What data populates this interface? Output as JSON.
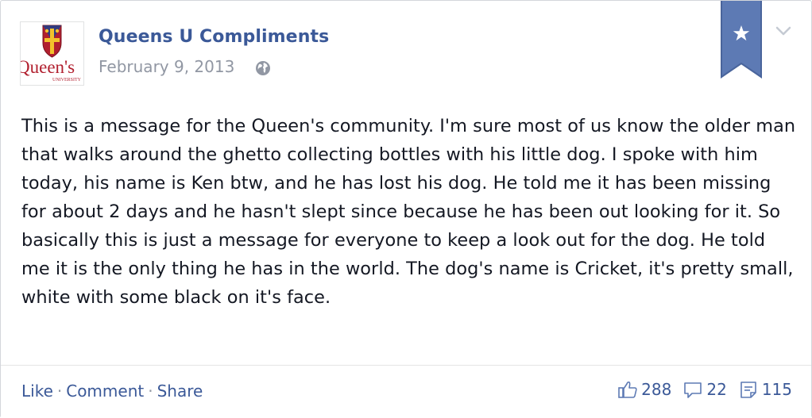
{
  "page": {
    "name": "Queens U Compliments",
    "date": "February 9, 2013",
    "avatar_text": "Queen's",
    "avatar_subtext": "UNIVERSITY"
  },
  "message": "This is a message for the Queen's community. I'm sure most of us know the older man that walks around the ghetto collecting bottles with his little dog. I spoke with him today, his name is Ken btw, and he has lost his dog. He told me it has been missing for about 2 days and he hasn't slept since because he has been out looking for it. So basically this is just a message for everyone to keep a look out for the dog. He told me it is the only thing he has in the world. The dog's name is Cricket, it's pretty small, white with some black on it's face.",
  "actions": {
    "like": "Like",
    "comment": "Comment",
    "share": "Share",
    "separator": "·"
  },
  "stats": {
    "likes": "288",
    "comments": "22",
    "shares": "115"
  },
  "icons": {
    "globe": "globe-icon",
    "star_ribbon": "star-ribbon-icon",
    "chevron": "chevron-down-icon",
    "like": "thumbs-up-icon",
    "comment": "comment-bubble-icon",
    "share": "share-doc-icon"
  },
  "colors": {
    "link_blue": "#3b5998",
    "ribbon_blue": "#5d7ab4",
    "meta_gray": "#9197a3",
    "text_dark": "#141823",
    "queens_red": "#b11f2e"
  }
}
